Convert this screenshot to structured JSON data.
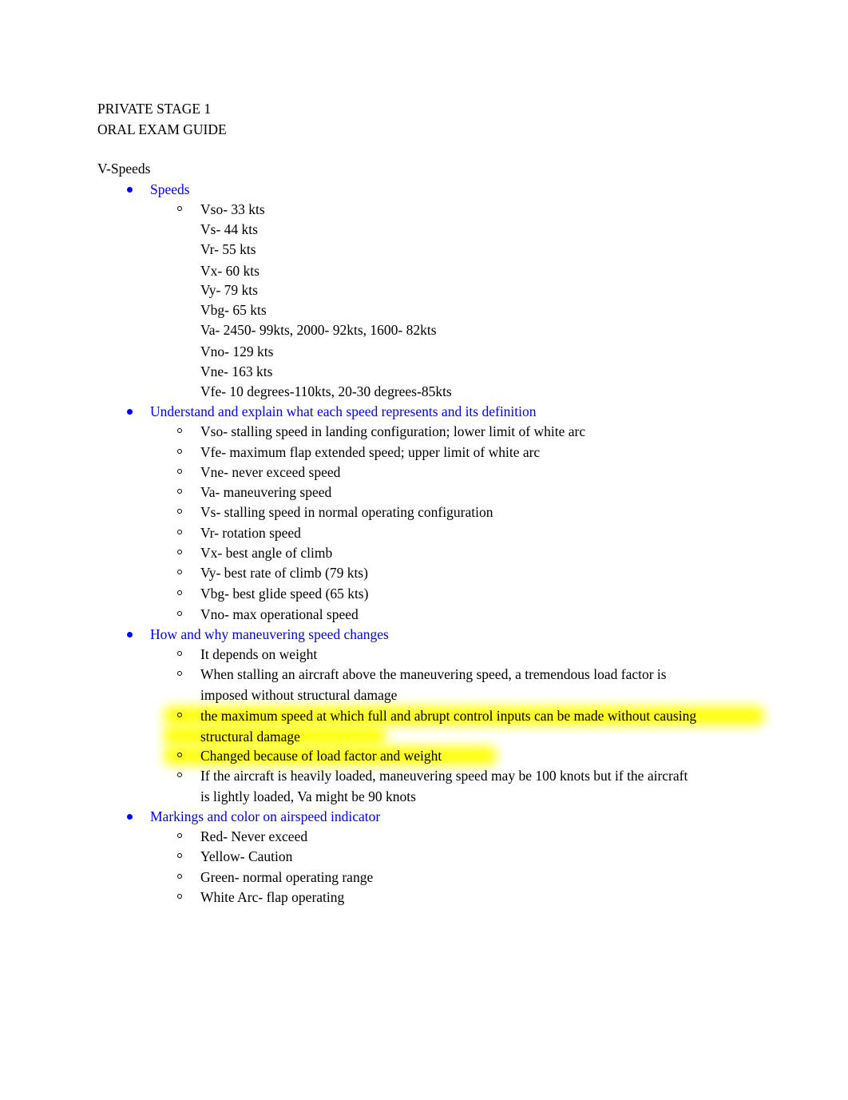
{
  "document": {
    "title_lines": [
      "PRIVATE STAGE 1",
      "ORAL EXAM GUIDE"
    ],
    "section_heading": "V-Speeds"
  },
  "colors": {
    "bullet_level1": "#0000FF",
    "text": "#000000",
    "highlight": "#FFFF00",
    "page_background": "#FFFFFF"
  },
  "sections": [
    {
      "heading": "Speeds",
      "items": [
        "Vso- 33 kts",
        "Vs- 44 kts",
        "Vr- 55 kts",
        "Vx- 60 kts",
        "Vy- 79 kts",
        "Vbg- 65 kts",
        "Va- 2450- 99kts, 2000- 92kts, 1600- 82kts",
        "Vno- 129 kts",
        "Vne- 163 kts",
        "Vfe- 10 degrees-110kts, 20-30 degrees-85kts"
      ]
    },
    {
      "heading": "Understand and explain what each speed represents and its definition",
      "items": [
        "Vso- stalling speed in landing configuration; lower limit of white arc",
        "Vfe- maximum flap extended speed; upper limit of white arc",
        "Vne- never exceed speed",
        "Va- maneuvering speed",
        "Vs- stalling speed in normal operating configuration",
        "Vr- rotation speed",
        "Vx- best angle of climb",
        "Vy- best rate of climb (79 kts)",
        "Vbg- best glide speed (65 kts)",
        "Vno- max operational speed"
      ]
    },
    {
      "heading": "How and why maneuvering speed changes",
      "items": [
        "It depends on weight",
        "When stalling an aircraft above the maneuvering speed, a tremendous load factor is imposed without structural damage",
        "the maximum speed at which full and abrupt control inputs can be made without causing structural damage",
        "Changed because of load factor and weight",
        "If the aircraft is heavily loaded, maneuvering speed may be 100 knots but if the aircraft is lightly loaded, Va might be 90 knots"
      ]
    },
    {
      "heading": "Markings and color on airspeed indicator",
      "items": [
        "Red- Never exceed",
        "Yellow- Caution",
        "Green- normal operating range",
        "White Arc- flap operating"
      ]
    }
  ]
}
